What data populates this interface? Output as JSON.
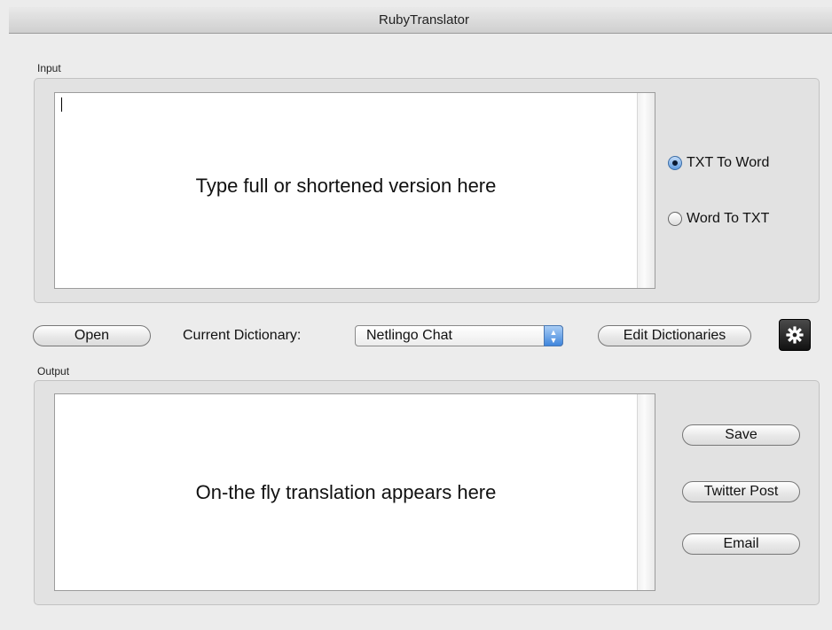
{
  "window": {
    "title": "RubyTranslator"
  },
  "input": {
    "label": "Input",
    "placeholder": "Type full or shortened version here",
    "value": ""
  },
  "mode": {
    "options": [
      {
        "label": "TXT To Word",
        "selected": true
      },
      {
        "label": "Word To TXT",
        "selected": false
      }
    ]
  },
  "toolbar": {
    "open_label": "Open",
    "dictionary_label": "Current Dictionary:",
    "dictionary_value": "Netlingo Chat",
    "edit_label": "Edit Dictionaries",
    "settings_icon": "gear-icon"
  },
  "output": {
    "label": "Output",
    "placeholder": "On-the fly translation appears here"
  },
  "actions": {
    "save_label": "Save",
    "twitter_label": "Twitter Post",
    "email_label": "Email"
  }
}
